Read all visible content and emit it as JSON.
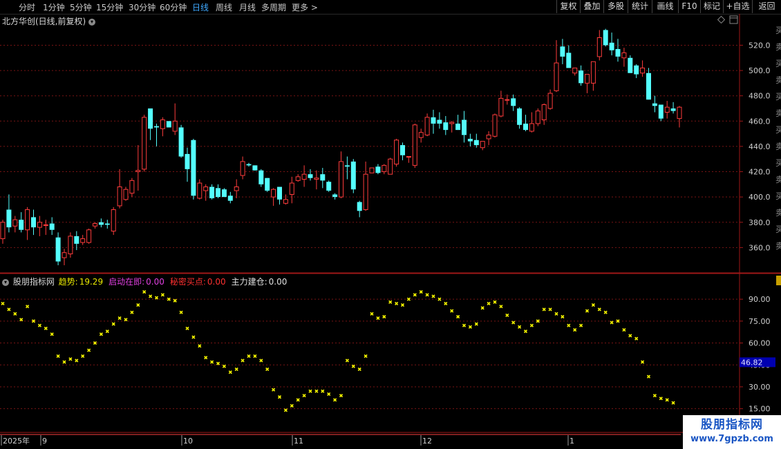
{
  "topbar": {
    "periods": [
      "分时",
      "1分钟",
      "5分钟",
      "15分钟",
      "30分钟",
      "60分钟",
      "日线",
      "周线",
      "月线",
      "多周期",
      "更多 >"
    ],
    "active_period": "日线",
    "buttons": [
      "复权",
      "叠加",
      "多股",
      "统计",
      "画线",
      "F10",
      "标记",
      "+自选",
      "返回"
    ]
  },
  "stock": {
    "title": "北方华创(日线,前复权)",
    "dropdown_icon": "chevron-down-icon",
    "top_right_icons": [
      "diamond-icon",
      "window-icon"
    ]
  },
  "right_edge_text": "买卖买卖买卖买卖买卖买卖买卖",
  "price_axis": {
    "ticks": [
      "520.0",
      "500.0",
      "480.0",
      "460.0",
      "440.0",
      "420.0",
      "400.0",
      "380.0",
      "360.0"
    ],
    "range": [
      340,
      535
    ]
  },
  "indicator": {
    "name": "股朋指标网",
    "fields": [
      {
        "label": "趋势:",
        "value": "19.29",
        "color": "#e8e800"
      },
      {
        "label": "启动在即:",
        "value": "0.00",
        "color": "#e040e0"
      },
      {
        "label": "秘密买点:",
        "value": "0.00",
        "color": "#ff3030"
      },
      {
        "label": "主力建仓:",
        "value": "0.00",
        "color": "#e0e0e0"
      }
    ],
    "axis_ticks": [
      "90.00",
      "75.00",
      "60.00",
      "45.00",
      "30.00",
      "15.00"
    ],
    "range": [
      12,
      100
    ],
    "current_label": "46.82"
  },
  "time_axis": {
    "labels": [
      "2025年",
      "9",
      "10",
      "11",
      "12",
      "1"
    ]
  },
  "watermark": {
    "line1": "股朋指标网",
    "line2": "www.7gpzb.com"
  },
  "colors": {
    "up": "#ff3c3c",
    "down": "#54ffff",
    "grid": "#7a1414",
    "trend": "#ffff00",
    "active_tab": "#3fa9ff"
  },
  "chart_data": {
    "type": "candlestick",
    "title": "北方华创(日线,前复权)",
    "ylim": [
      340,
      535
    ],
    "candles": [
      {
        "o": 367,
        "h": 382,
        "l": 363,
        "c": 380
      },
      {
        "o": 390,
        "h": 402,
        "l": 372,
        "c": 376
      },
      {
        "o": 377,
        "h": 385,
        "l": 372,
        "c": 382
      },
      {
        "o": 382,
        "h": 388,
        "l": 372,
        "c": 374
      },
      {
        "o": 374,
        "h": 392,
        "l": 366,
        "c": 390
      },
      {
        "o": 384,
        "h": 390,
        "l": 370,
        "c": 376
      },
      {
        "o": 376,
        "h": 385,
        "l": 369,
        "c": 380
      },
      {
        "o": 378,
        "h": 382,
        "l": 370,
        "c": 378
      },
      {
        "o": 379,
        "h": 384,
        "l": 370,
        "c": 374
      },
      {
        "o": 368,
        "h": 372,
        "l": 346,
        "c": 349
      },
      {
        "o": 352,
        "h": 359,
        "l": 346,
        "c": 356
      },
      {
        "o": 355,
        "h": 372,
        "l": 352,
        "c": 369
      },
      {
        "o": 369,
        "h": 373,
        "l": 358,
        "c": 363
      },
      {
        "o": 364,
        "h": 370,
        "l": 362,
        "c": 367
      },
      {
        "o": 364,
        "h": 375,
        "l": 363,
        "c": 374
      },
      {
        "o": 377,
        "h": 380,
        "l": 375,
        "c": 379
      },
      {
        "o": 380,
        "h": 383,
        "l": 376,
        "c": 378
      },
      {
        "o": 379,
        "h": 382,
        "l": 375,
        "c": 378
      },
      {
        "o": 373,
        "h": 392,
        "l": 370,
        "c": 390
      },
      {
        "o": 393,
        "h": 422,
        "l": 391,
        "c": 408
      },
      {
        "o": 398,
        "h": 408,
        "l": 397,
        "c": 406
      },
      {
        "o": 403,
        "h": 415,
        "l": 400,
        "c": 413
      },
      {
        "o": 420,
        "h": 441,
        "l": 405,
        "c": 421
      },
      {
        "o": 422,
        "h": 465,
        "l": 420,
        "c": 463
      },
      {
        "o": 470,
        "h": 470,
        "l": 445,
        "c": 454
      },
      {
        "o": 456,
        "h": 458,
        "l": 440,
        "c": 455
      },
      {
        "o": 454,
        "h": 463,
        "l": 448,
        "c": 461
      },
      {
        "o": 460,
        "h": 460,
        "l": 455,
        "c": 455
      },
      {
        "o": 452,
        "h": 474,
        "l": 449,
        "c": 460
      },
      {
        "o": 455,
        "h": 457,
        "l": 431,
        "c": 432
      },
      {
        "o": 434,
        "h": 439,
        "l": 412,
        "c": 422
      },
      {
        "o": 445,
        "h": 446,
        "l": 398,
        "c": 401
      },
      {
        "o": 399,
        "h": 414,
        "l": 398,
        "c": 411
      },
      {
        "o": 405,
        "h": 410,
        "l": 397,
        "c": 408
      },
      {
        "o": 408,
        "h": 410,
        "l": 398,
        "c": 399
      },
      {
        "o": 407,
        "h": 410,
        "l": 399,
        "c": 400
      },
      {
        "o": 406,
        "h": 407,
        "l": 400,
        "c": 400
      },
      {
        "o": 401,
        "h": 404,
        "l": 395,
        "c": 397
      },
      {
        "o": 405,
        "h": 414,
        "l": 399,
        "c": 408
      },
      {
        "o": 417,
        "h": 432,
        "l": 414,
        "c": 428
      },
      {
        "o": 426,
        "h": 427,
        "l": 424,
        "c": 425
      },
      {
        "o": 425,
        "h": 425,
        "l": 421,
        "c": 421
      },
      {
        "o": 421,
        "h": 422,
        "l": 408,
        "c": 410
      },
      {
        "o": 415,
        "h": 415,
        "l": 404,
        "c": 405
      },
      {
        "o": 400,
        "h": 407,
        "l": 393,
        "c": 406
      },
      {
        "o": 408,
        "h": 408,
        "l": 394,
        "c": 398
      },
      {
        "o": 395,
        "h": 402,
        "l": 394,
        "c": 398
      },
      {
        "o": 402,
        "h": 416,
        "l": 395,
        "c": 411
      },
      {
        "o": 413,
        "h": 418,
        "l": 412,
        "c": 416
      },
      {
        "o": 414,
        "h": 425,
        "l": 408,
        "c": 418
      },
      {
        "o": 418,
        "h": 422,
        "l": 413,
        "c": 415
      },
      {
        "o": 414,
        "h": 421,
        "l": 406,
        "c": 415
      },
      {
        "o": 418,
        "h": 423,
        "l": 407,
        "c": 413
      },
      {
        "o": 412,
        "h": 413,
        "l": 404,
        "c": 405
      },
      {
        "o": 402,
        "h": 403,
        "l": 398,
        "c": 400
      },
      {
        "o": 400,
        "h": 436,
        "l": 399,
        "c": 428
      },
      {
        "o": 425,
        "h": 432,
        "l": 414,
        "c": 424
      },
      {
        "o": 428,
        "h": 430,
        "l": 403,
        "c": 406
      },
      {
        "o": 396,
        "h": 397,
        "l": 384,
        "c": 389
      },
      {
        "o": 390,
        "h": 428,
        "l": 389,
        "c": 418
      },
      {
        "o": 419,
        "h": 423,
        "l": 419,
        "c": 423
      },
      {
        "o": 424,
        "h": 426,
        "l": 418,
        "c": 419
      },
      {
        "o": 420,
        "h": 426,
        "l": 418,
        "c": 425
      },
      {
        "o": 418,
        "h": 431,
        "l": 418,
        "c": 430
      },
      {
        "o": 426,
        "h": 446,
        "l": 424,
        "c": 445
      },
      {
        "o": 441,
        "h": 443,
        "l": 429,
        "c": 433
      },
      {
        "o": 432,
        "h": 432,
        "l": 427,
        "c": 432
      },
      {
        "o": 425,
        "h": 458,
        "l": 423,
        "c": 457
      },
      {
        "o": 447,
        "h": 454,
        "l": 443,
        "c": 451
      },
      {
        "o": 449,
        "h": 466,
        "l": 448,
        "c": 463
      },
      {
        "o": 463,
        "h": 469,
        "l": 450,
        "c": 458
      },
      {
        "o": 461,
        "h": 467,
        "l": 454,
        "c": 458
      },
      {
        "o": 459,
        "h": 464,
        "l": 449,
        "c": 453
      },
      {
        "o": 458,
        "h": 460,
        "l": 451,
        "c": 459
      },
      {
        "o": 458,
        "h": 465,
        "l": 453,
        "c": 453
      },
      {
        "o": 461,
        "h": 468,
        "l": 443,
        "c": 449
      },
      {
        "o": 446,
        "h": 450,
        "l": 440,
        "c": 444
      },
      {
        "o": 445,
        "h": 450,
        "l": 439,
        "c": 441
      },
      {
        "o": 439,
        "h": 443,
        "l": 437,
        "c": 444
      },
      {
        "o": 446,
        "h": 452,
        "l": 441,
        "c": 449
      },
      {
        "o": 448,
        "h": 466,
        "l": 447,
        "c": 465
      },
      {
        "o": 464,
        "h": 484,
        "l": 463,
        "c": 478
      },
      {
        "o": 477,
        "h": 481,
        "l": 473,
        "c": 477
      },
      {
        "o": 478,
        "h": 481,
        "l": 468,
        "c": 472
      },
      {
        "o": 470,
        "h": 471,
        "l": 454,
        "c": 457
      },
      {
        "o": 458,
        "h": 465,
        "l": 452,
        "c": 453
      },
      {
        "o": 452,
        "h": 467,
        "l": 451,
        "c": 458
      },
      {
        "o": 458,
        "h": 470,
        "l": 456,
        "c": 468
      },
      {
        "o": 461,
        "h": 474,
        "l": 457,
        "c": 473
      },
      {
        "o": 470,
        "h": 485,
        "l": 469,
        "c": 482
      },
      {
        "o": 484,
        "h": 524,
        "l": 483,
        "c": 506
      },
      {
        "o": 519,
        "h": 525,
        "l": 505,
        "c": 511
      },
      {
        "o": 514,
        "h": 520,
        "l": 503,
        "c": 502
      },
      {
        "o": 498,
        "h": 502,
        "l": 496,
        "c": 502
      },
      {
        "o": 500,
        "h": 504,
        "l": 488,
        "c": 490
      },
      {
        "o": 490,
        "h": 497,
        "l": 482,
        "c": 497
      },
      {
        "o": 490,
        "h": 506,
        "l": 484,
        "c": 507
      },
      {
        "o": 511,
        "h": 532,
        "l": 508,
        "c": 526
      },
      {
        "o": 532,
        "h": 533,
        "l": 519,
        "c": 520
      },
      {
        "o": 522,
        "h": 530,
        "l": 512,
        "c": 516
      },
      {
        "o": 517,
        "h": 525,
        "l": 507,
        "c": 511
      },
      {
        "o": 510,
        "h": 518,
        "l": 503,
        "c": 514
      },
      {
        "o": 510,
        "h": 512,
        "l": 498,
        "c": 498
      },
      {
        "o": 504,
        "h": 505,
        "l": 494,
        "c": 497
      },
      {
        "o": 498,
        "h": 508,
        "l": 495,
        "c": 502
      },
      {
        "o": 498,
        "h": 502,
        "l": 477,
        "c": 477
      },
      {
        "o": 474,
        "h": 480,
        "l": 467,
        "c": 472
      },
      {
        "o": 473,
        "h": 473,
        "l": 460,
        "c": 462
      },
      {
        "o": 467,
        "h": 476,
        "l": 462,
        "c": 471
      },
      {
        "o": 470,
        "h": 475,
        "l": 466,
        "c": 468
      },
      {
        "o": 462,
        "h": 472,
        "l": 455,
        "c": 471
      }
    ],
    "trend_line": [
      87,
      83,
      80,
      76,
      85,
      75,
      72,
      70,
      66,
      51,
      47,
      49,
      48,
      51,
      55,
      60,
      66,
      68,
      73,
      77,
      76,
      81,
      86,
      95,
      92,
      91,
      93,
      90,
      89,
      81,
      70,
      64,
      58,
      50,
      47,
      46,
      44,
      40,
      42,
      48,
      51,
      51,
      48,
      42,
      28,
      23,
      14,
      17,
      21,
      24,
      27,
      27,
      27,
      25,
      21,
      24,
      48,
      44,
      42,
      51,
      80,
      77,
      78,
      88,
      87,
      86,
      90,
      93,
      95,
      93,
      92,
      90,
      87,
      82,
      78,
      72,
      71,
      73,
      84,
      87,
      88,
      85,
      79,
      74,
      71,
      68,
      72,
      75,
      83,
      83,
      80,
      78,
      72,
      69,
      72,
      82,
      86,
      83,
      81,
      74,
      75,
      69,
      65,
      63,
      47,
      37,
      24,
      22,
      21,
      19
    ]
  }
}
